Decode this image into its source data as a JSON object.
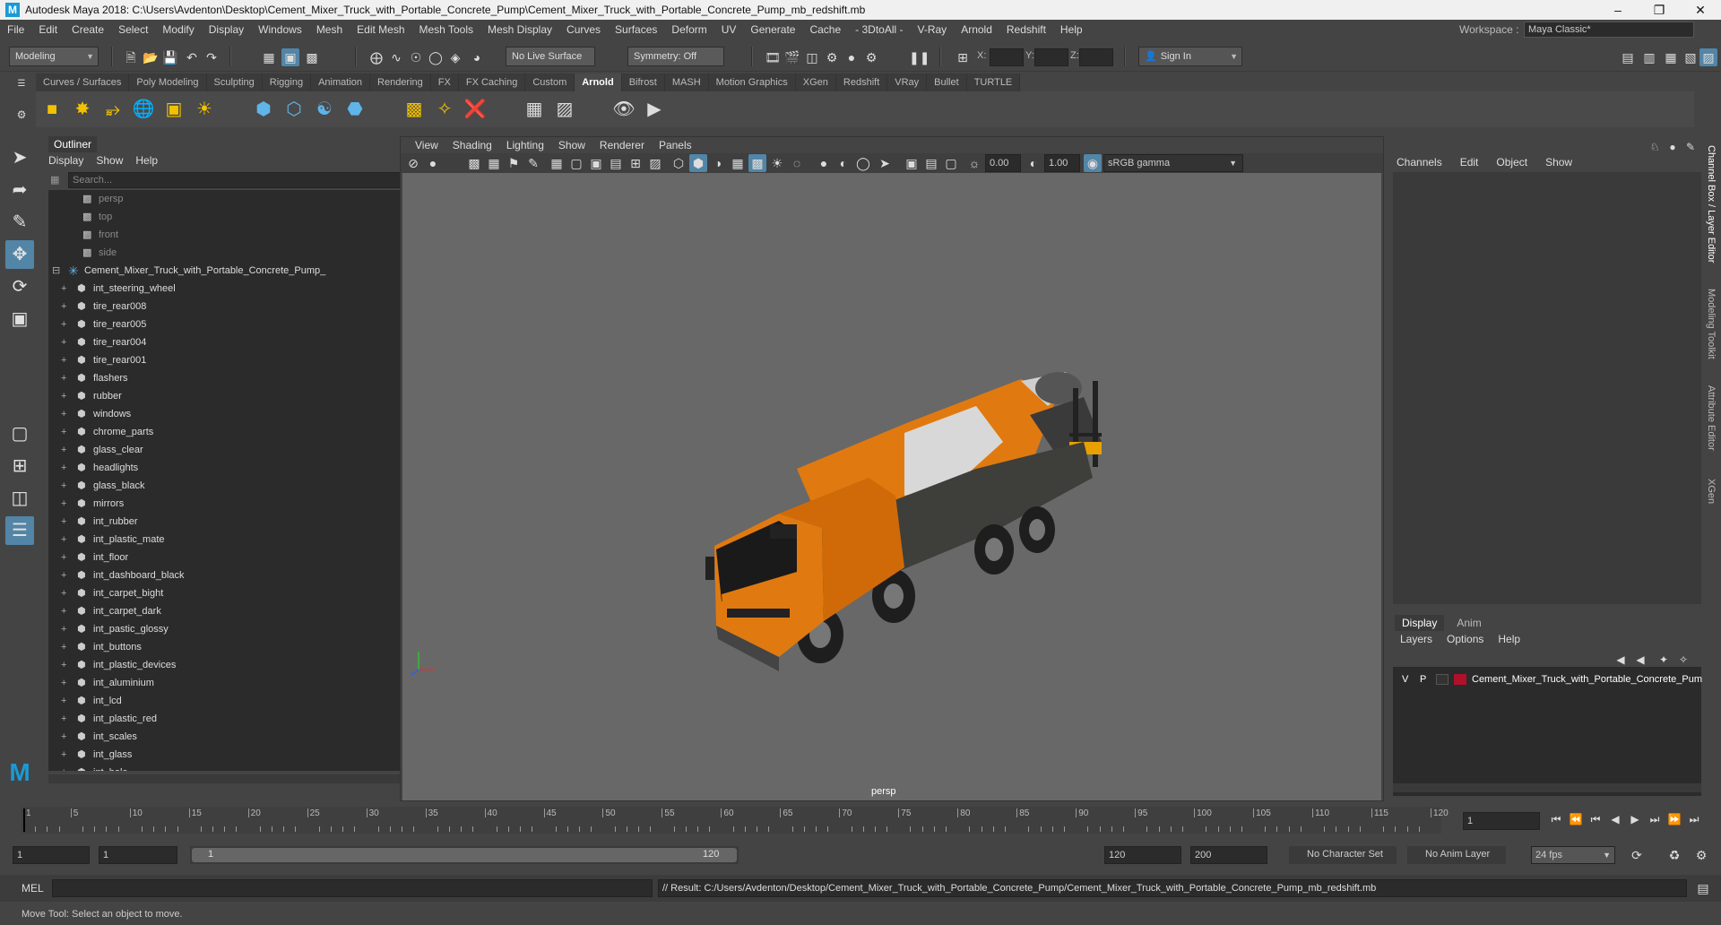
{
  "window": {
    "title": "Autodesk Maya 2018: C:\\Users\\Avdenton\\Desktop\\Cement_Mixer_Truck_with_Portable_Concrete_Pump\\Cement_Mixer_Truck_with_Portable_Concrete_Pump_mb_redshift.mb"
  },
  "menubar": {
    "items": [
      "File",
      "Edit",
      "Create",
      "Select",
      "Modify",
      "Display",
      "Windows",
      "Mesh",
      "Edit Mesh",
      "Mesh Tools",
      "Mesh Display",
      "Curves",
      "Surfaces",
      "Deform",
      "UV",
      "Generate",
      "Cache",
      "- 3DtoAll -",
      "V-Ray",
      "Arnold",
      "Redshift",
      "Help"
    ],
    "workspace_label": "Workspace :",
    "workspace_value": "Maya Classic*"
  },
  "statusline": {
    "mode": "Modeling",
    "live_surface": "No Live Surface",
    "symmetry": "Symmetry: Off",
    "x_label": "X:",
    "y_label": "Y:",
    "z_label": "Z:",
    "sign_in": "Sign In"
  },
  "shelf": {
    "tabs": [
      "Curves / Surfaces",
      "Poly Modeling",
      "Sculpting",
      "Rigging",
      "Animation",
      "Rendering",
      "FX",
      "FX Caching",
      "Custom",
      "Arnold",
      "Bifrost",
      "MASH",
      "Motion Graphics",
      "XGen",
      "Redshift",
      "VRay",
      "Bullet",
      "TURTLE"
    ],
    "active_tab": "Arnold"
  },
  "outliner": {
    "title": "Outliner",
    "menu": [
      "Display",
      "Show",
      "Help"
    ],
    "search_placeholder": "Search...",
    "cameras": [
      "persp",
      "top",
      "front",
      "side"
    ],
    "root": "Cement_Mixer_Truck_with_Portable_Concrete_Pump_",
    "children": [
      "int_steering_wheel",
      "tire_rear008",
      "tire_rear005",
      "tire_rear004",
      "tire_rear001",
      "flashers",
      "rubber",
      "windows",
      "chrome_parts",
      "glass_clear",
      "headlights",
      "glass_black",
      "mirrors",
      "int_rubber",
      "int_plastic_mate",
      "int_floor",
      "int_dashboard_black",
      "int_carpet_bight",
      "int_carpet_dark",
      "int_pastic_glossy",
      "int_buttons",
      "int_plastic_devices",
      "int_aluminium",
      "int_lcd",
      "int_plastic_red",
      "int_scales",
      "int_glass",
      "int_hole"
    ]
  },
  "viewport": {
    "menu": [
      "View",
      "Shading",
      "Lighting",
      "Show",
      "Renderer",
      "Panels"
    ],
    "exposure": "0.00",
    "gamma": "1.00",
    "color_space": "sRGB gamma",
    "camera": "persp",
    "truck_colors": {
      "body": "#e07a10",
      "drum_white": "#d8d8d8",
      "chassis": "#3a3a3a"
    }
  },
  "channelbox": {
    "menu": [
      "Channels",
      "Edit",
      "Object",
      "Show"
    ],
    "layer_tabs": [
      "Display",
      "Anim"
    ],
    "layer_menu": [
      "Layers",
      "Options",
      "Help"
    ],
    "layer": {
      "v": "V",
      "p": "P",
      "name": "Cement_Mixer_Truck_with_Portable_Concrete_Pum",
      "color": "#b0102a"
    },
    "side_tabs": [
      "Channel Box / Layer Editor",
      "Modeling Toolkit",
      "Attribute Editor",
      "XGen"
    ]
  },
  "timeslider": {
    "ticks": [
      "1",
      "5",
      "10",
      "15",
      "20",
      "25",
      "30",
      "35",
      "40",
      "45",
      "50",
      "55",
      "60",
      "65",
      "70",
      "75",
      "80",
      "85",
      "90",
      "95",
      "100",
      "105",
      "110",
      "115",
      "120"
    ],
    "current_frame": "1"
  },
  "rangeslider": {
    "start": "1",
    "anim_start": "1",
    "range_start_label": "1",
    "range_end_label": "120",
    "end": "120",
    "anim_end": "200",
    "character_set": "No Character Set",
    "anim_layer": "No Anim Layer",
    "fps": "24 fps"
  },
  "cmdline": {
    "label": "MEL",
    "result": "// Result: C:/Users/Avdenton/Desktop/Cement_Mixer_Truck_with_Portable_Concrete_Pump/Cement_Mixer_Truck_with_Portable_Concrete_Pump_mb_redshift.mb"
  },
  "helpline": {
    "text": "Move Tool: Select an object to move."
  }
}
